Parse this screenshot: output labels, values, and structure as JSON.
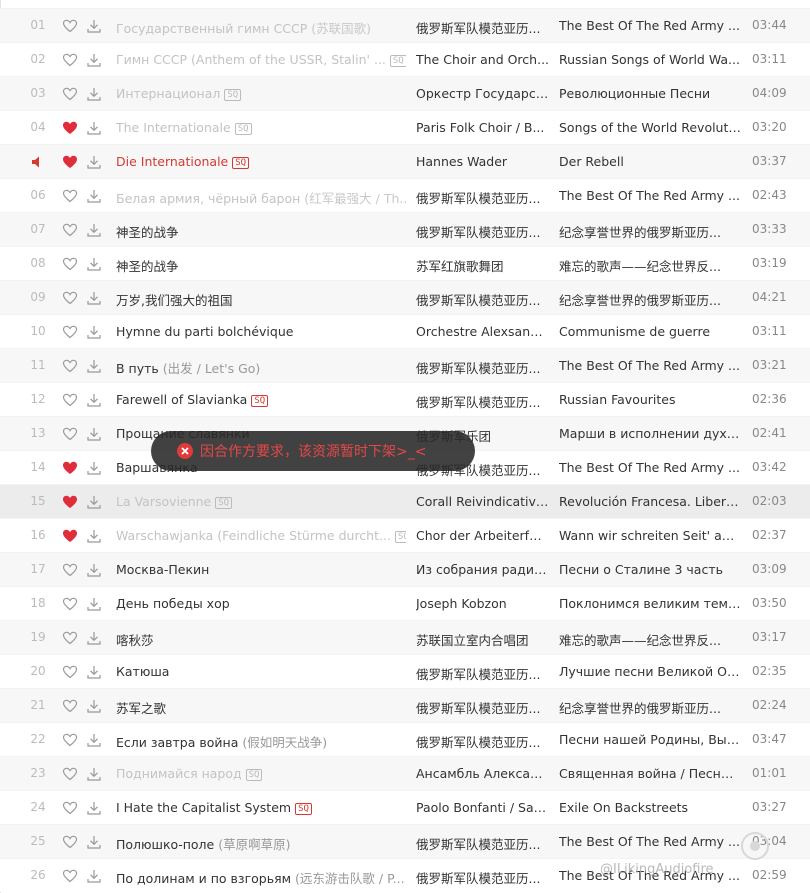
{
  "tracks": [
    {
      "idx": "01",
      "title": "Государственный гимн СССР",
      "alias": "(苏联国歌)",
      "sq": false,
      "artist": "俄罗斯军队模范亚历...",
      "album": "The Best Of The Red Army ...",
      "duration": "03:44",
      "liked": false,
      "dim": true,
      "active": false
    },
    {
      "idx": "02",
      "title": "Гимн СССР (Anthem of the USSR, Stalin' ...",
      "alias": "",
      "sq": true,
      "artist": "The Choir and Orch...",
      "album": "Russian Songs of World Wa...",
      "duration": "03:11",
      "liked": false,
      "dim": true,
      "active": false
    },
    {
      "idx": "03",
      "title": "Интернационал",
      "alias": "",
      "sq": true,
      "artist": "Оркестр Государст...",
      "album": "Революционные Песни",
      "duration": "04:09",
      "liked": false,
      "dim": true,
      "active": false
    },
    {
      "idx": "04",
      "title": "The Internationale",
      "alias": "",
      "sq": true,
      "artist": "Paris Folk Choir / B...",
      "album": "Songs of the World Revolutio...",
      "duration": "03:20",
      "liked": true,
      "dim": true,
      "active": false
    },
    {
      "idx": "",
      "title": "Die Internationale",
      "alias": "",
      "sq": true,
      "artist": "Hannes Wader",
      "album": "Der Rebell",
      "duration": "03:37",
      "liked": true,
      "dim": false,
      "active": true
    },
    {
      "idx": "06",
      "title": "Белая армия, чёрный барон",
      "alias": "(红军最强大 / Th...",
      "sq": false,
      "artist": "俄罗斯军队模范亚历...",
      "album": "The Best Of The Red Army ...",
      "duration": "02:43",
      "liked": false,
      "dim": true,
      "active": false
    },
    {
      "idx": "07",
      "title": "神圣的战争",
      "alias": "",
      "sq": false,
      "artist": "俄罗斯军队模范亚历...",
      "album": "纪念享誉世界的俄罗斯亚历...",
      "duration": "03:33",
      "liked": false,
      "dim": false,
      "active": false
    },
    {
      "idx": "08",
      "title": "神圣的战争",
      "alias": "",
      "sq": false,
      "artist": "苏军红旗歌舞团",
      "album": "难忘的歌声——纪念世界反...",
      "duration": "03:19",
      "liked": false,
      "dim": false,
      "active": false
    },
    {
      "idx": "09",
      "title": "万岁,我们强大的祖国",
      "alias": "",
      "sq": false,
      "artist": "俄罗斯军队模范亚历...",
      "album": "纪念享誉世界的俄罗斯亚历...",
      "duration": "04:21",
      "liked": false,
      "dim": false,
      "active": false
    },
    {
      "idx": "10",
      "title": "Hymne du parti bolchévique",
      "alias": "",
      "sq": false,
      "artist": "Orchestre Alexsandrov",
      "album": "Communisme de guerre",
      "duration": "03:11",
      "liked": false,
      "dim": false,
      "active": false
    },
    {
      "idx": "11",
      "title": "В путь",
      "alias": "(出发 / Let's Go)",
      "sq": false,
      "artist": "俄罗斯军队模范亚历...",
      "album": "The Best Of The Red Army ...",
      "duration": "03:21",
      "liked": false,
      "dim": false,
      "active": false
    },
    {
      "idx": "12",
      "title": "Farewell of Slavianka",
      "alias": "",
      "sq": true,
      "artist": "俄罗斯军队模范亚历...",
      "album": "Russian Favourites",
      "duration": "02:36",
      "liked": false,
      "dim": false,
      "active": false
    },
    {
      "idx": "13",
      "title": "Прощание славянки",
      "alias": "",
      "sq": false,
      "artist": "俄罗斯军乐团",
      "album": "Марши в исполнении духо...",
      "duration": "02:41",
      "liked": false,
      "dim": false,
      "active": false
    },
    {
      "idx": "14",
      "title": "Варшавянка",
      "alias": "",
      "sq": false,
      "artist": "俄罗斯军队模范亚历...",
      "album": "The Best Of The Red Army ...",
      "duration": "03:42",
      "liked": true,
      "dim": false,
      "active": false
    },
    {
      "idx": "15",
      "title": "La Varsovienne",
      "alias": "",
      "sq": true,
      "artist": "Corall Reivindicativa...",
      "album": "Revolución Francesa. Liberta...",
      "duration": "02:03",
      "liked": true,
      "dim": true,
      "active": false,
      "hover": true
    },
    {
      "idx": "16",
      "title": "Warschawjanka (Feindliche Stürme durcht...",
      "alias": "",
      "sq": true,
      "artist": "Chor der Arbeiterfes...",
      "album": "Wann wir schreiten Seit' an ...",
      "duration": "02:37",
      "liked": true,
      "dim": true,
      "active": false
    },
    {
      "idx": "17",
      "title": "Москва-Пекин",
      "alias": "",
      "sq": false,
      "artist": "Из собрания радио...",
      "album": "Песни о Сталине 3 часть",
      "duration": "03:09",
      "liked": false,
      "dim": false,
      "active": false
    },
    {
      "idx": "18",
      "title": "День победы хор",
      "alias": "",
      "sq": false,
      "artist": "Joseph Kobzon",
      "album": "Поклонимся великим тем г...",
      "duration": "03:50",
      "liked": false,
      "dim": false,
      "active": false
    },
    {
      "idx": "19",
      "title": "喀秋莎",
      "alias": "",
      "sq": false,
      "artist": "苏联国立室内合唱团",
      "album": "难忘的歌声——纪念世界反...",
      "duration": "03:17",
      "liked": false,
      "dim": false,
      "active": false
    },
    {
      "idx": "20",
      "title": "Катюша",
      "alias": "",
      "sq": false,
      "artist": "俄罗斯军队模范亚历...",
      "album": "Лучшие песни Великой Оте...",
      "duration": "02:35",
      "liked": false,
      "dim": false,
      "active": false
    },
    {
      "idx": "21",
      "title": "苏军之歌",
      "alias": "",
      "sq": false,
      "artist": "俄罗斯军队模范亚历...",
      "album": "纪念享誉世界的俄罗斯亚历...",
      "duration": "02:24",
      "liked": false,
      "dim": false,
      "active": false
    },
    {
      "idx": "22",
      "title": "Если завтра война",
      "alias": "(假如明天战争)",
      "sq": false,
      "artist": "俄罗斯军队模范亚历...",
      "album": "Песни нашей Родины, Вып...",
      "duration": "03:47",
      "liked": false,
      "dim": false,
      "active": false
    },
    {
      "idx": "23",
      "title": "Поднимайся народ",
      "alias": "",
      "sq": true,
      "artist": "Ансамбль Алексан...",
      "album": "Священная война / Песни ...",
      "duration": "01:01",
      "liked": false,
      "dim": true,
      "active": false
    },
    {
      "idx": "24",
      "title": "I Hate the Capitalist System",
      "alias": "",
      "sq": true,
      "artist": "Paolo Bonfanti / Sar...",
      "album": "Exile On Backstreets",
      "duration": "03:27",
      "liked": false,
      "dim": false,
      "active": false
    },
    {
      "idx": "25",
      "title": "Полюшко-поле",
      "alias": "(草原啊草原)",
      "sq": false,
      "artist": "俄罗斯军队模范亚历...",
      "album": "The Best Of The Red Army ...",
      "duration": "03:04",
      "liked": false,
      "dim": false,
      "active": false
    },
    {
      "idx": "26",
      "title": "По долинам и по взгорьям",
      "alias": "(远东游击队歌 / P...",
      "sq": false,
      "artist": "俄罗斯军队模范亚历...",
      "album": "The Best Of The Red Army ...",
      "duration": "02:59",
      "liked": false,
      "dim": false,
      "active": false
    }
  ],
  "sq_label": "SQ",
  "toast": {
    "message": "因合作方要求，该资源暂时下架>_<"
  },
  "watermark": "@ILikingAudiofire",
  "colors": {
    "accent": "#d33a31",
    "heart_on": "#e02d3c"
  }
}
